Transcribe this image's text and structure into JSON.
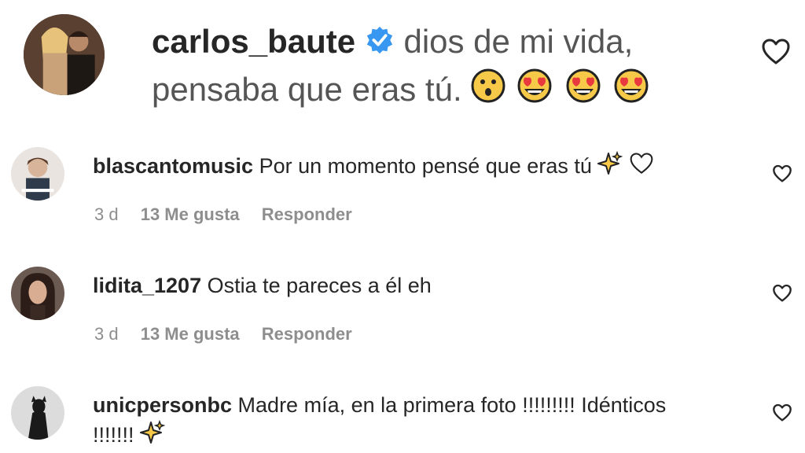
{
  "main_comment": {
    "username": "carlos_baute",
    "text_line1": "dios de mi vida,",
    "text_line2": "pensaba que eras tú.",
    "like_icon": "heart-outline-icon"
  },
  "replies": [
    {
      "username": "blascantomusic",
      "text": "Por un momento pensé que eras tú",
      "time": "3 d",
      "likes": "13 Me gusta",
      "reply_label": "Responder"
    },
    {
      "username": "lidita_1207",
      "text": "Ostia te pareces a él eh",
      "time": "3 d",
      "likes": "13 Me gusta",
      "reply_label": "Responder"
    },
    {
      "username": "unicpersonbc",
      "text_line1": "Madre mía, en la primera foto !!!!!!!!! Idénticos",
      "text_line2": "!!!!!!!"
    }
  ],
  "colors": {
    "verified": "#3897f0",
    "meta_gray": "#8e8e8e",
    "sparkle": "#f7c948"
  }
}
